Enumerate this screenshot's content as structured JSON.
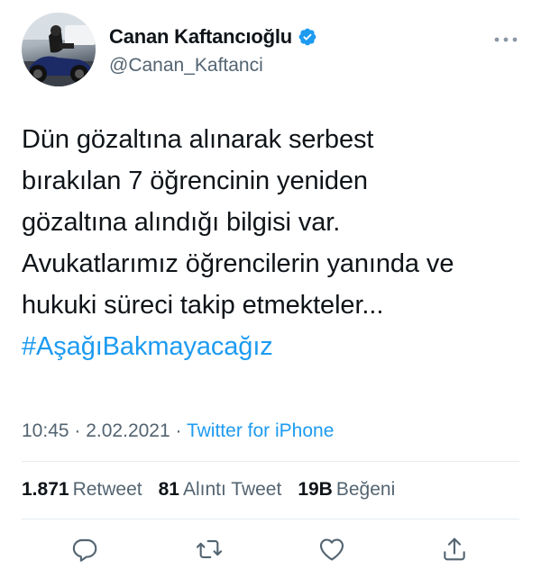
{
  "user": {
    "display_name": "Canan Kaftancıoğlu",
    "handle": "@Canan_Kaftanci",
    "verified": true
  },
  "tweet": {
    "lines": [
      "Dün gözaltına alınarak serbest",
      "bırakılan 7 öğrencinin yeniden",
      "gözaltına alındığı bilgisi var.",
      "Avukatlarımız öğrencilerin yanında ve",
      "hukuki süreci takip etmekteler..."
    ],
    "hashtag": "#AşağıBakmayacağız"
  },
  "meta": {
    "time": "10:45",
    "date": "2.02.2021",
    "separator": "·",
    "source": "Twitter for iPhone"
  },
  "stats": {
    "retweets": {
      "count": "1.871",
      "label": "Retweet"
    },
    "quotes": {
      "count": "81",
      "label": "Alıntı Tweet"
    },
    "likes": {
      "count": "19B",
      "label": "Beğeni"
    }
  },
  "icons": {
    "verified": "verified-badge-icon",
    "more": "more-options-icon",
    "reply": "reply-icon",
    "retweet": "retweet-icon",
    "like": "like-icon",
    "share": "share-icon"
  },
  "colors": {
    "accent": "#1d9bf0",
    "text": "#0f1419",
    "secondary": "#536471",
    "divider": "#e6ecf0"
  }
}
